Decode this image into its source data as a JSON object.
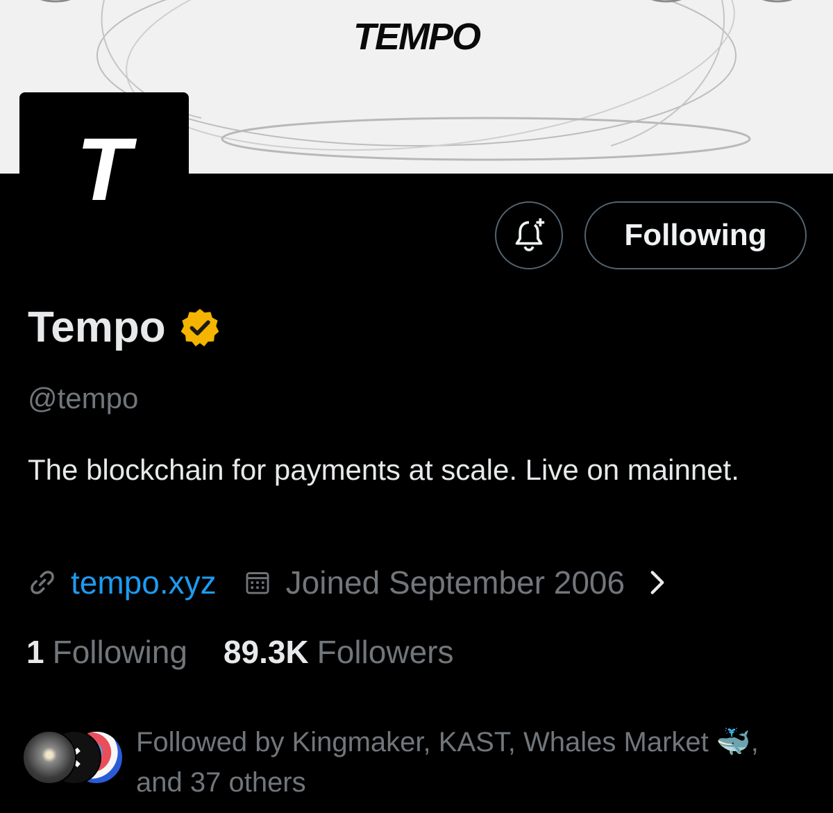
{
  "banner": {
    "logo_text": "TEMPO"
  },
  "avatar": {
    "letter": "T"
  },
  "actions": {
    "notify_icon": "bell-plus-icon",
    "follow_label": "Following"
  },
  "profile": {
    "name": "Tempo",
    "verified_icon": "verified-gold-badge-icon",
    "badge_color": "#f4b400",
    "handle": "@tempo",
    "bio": "The blockchain for payments at scale. Live on mainnet.",
    "website": "tempo.xyz",
    "joined": "Joined September 2006",
    "link_color": "#1d9bf0"
  },
  "stats": {
    "following_count": "1",
    "following_label": "Following",
    "followers_count": "89.3K",
    "followers_label": "Followers"
  },
  "mutual": {
    "prefix": "Followed by Kingmaker, KAST, Whales Market ",
    "emoji": "🐳",
    "suffix": ",",
    "line2": "and 37 others"
  }
}
